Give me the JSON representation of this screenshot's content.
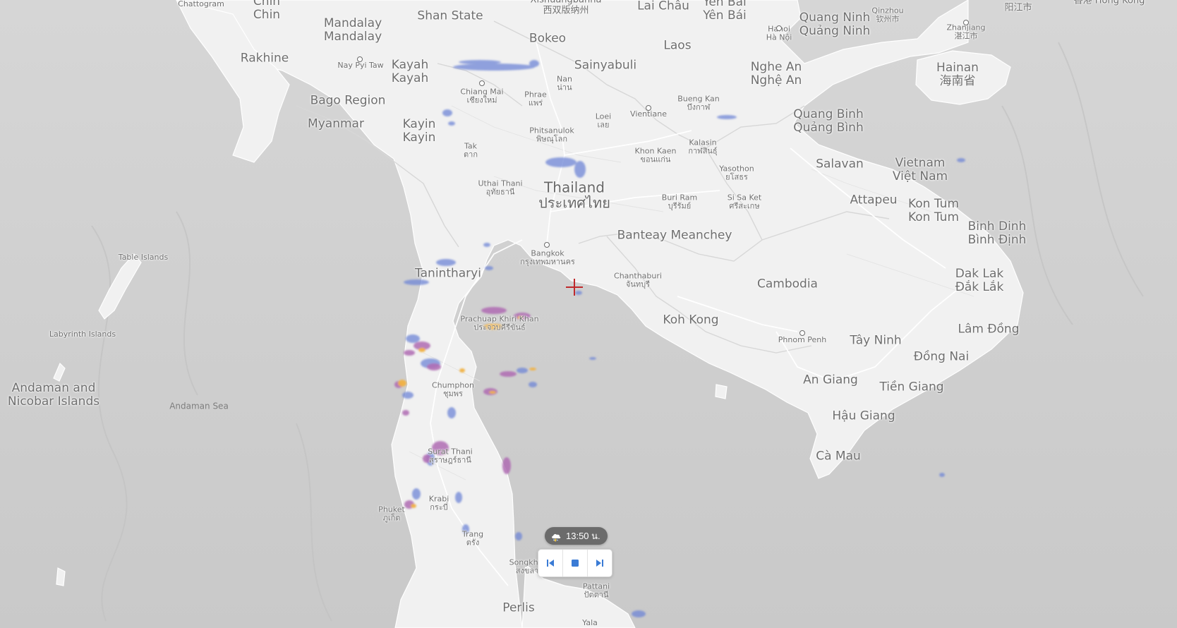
{
  "map": {
    "colors": {
      "water": "#cfcfcf",
      "land": "#f1f1f1",
      "border": "#dcdcdc",
      "roads": "#ffffff",
      "radar_light": "#6f86d6",
      "radar_mid": "#b06bb3",
      "radar_heavy": "#f2b344"
    },
    "marker": {
      "name": "crosshair-marker",
      "color": "#c0292b"
    }
  },
  "labels": [
    {
      "id": "chattogram",
      "text": "Chattogram",
      "level": "l4"
    },
    {
      "id": "chin",
      "text": "Chin",
      "alt": "Chin",
      "level": "l2"
    },
    {
      "id": "mandalay",
      "text": "Mandalay",
      "alt": "Mandalay",
      "level": "l2"
    },
    {
      "id": "shan-state",
      "text": "Shan State",
      "level": "l2"
    },
    {
      "id": "xishuangbanna",
      "text": "Xishuangbanna",
      "alt": "西双版纳州",
      "level": "l3"
    },
    {
      "id": "lai-chau",
      "text": "Lai Châu",
      "level": "l2"
    },
    {
      "id": "yen-bai",
      "text": "Yên Bái",
      "alt": "Yên Bái",
      "level": "l2"
    },
    {
      "id": "qinzhou",
      "text": "Qinzhou",
      "alt": "钦州市",
      "level": "l4"
    },
    {
      "id": "quang-ninh",
      "text": "Quang Ninh",
      "alt": "Quảng Ninh",
      "level": "l2"
    },
    {
      "id": "hanoi",
      "text": "Hanoi",
      "alt": "Hà Nội",
      "level": "l4"
    },
    {
      "id": "zhanjiang",
      "text": "Zhanjiang",
      "alt": "湛江市",
      "level": "l4"
    },
    {
      "id": "yangjiang",
      "text": "阳江市",
      "level": "l3"
    },
    {
      "id": "hong-kong",
      "text": "香港 Hong Kong",
      "level": "l3"
    },
    {
      "id": "hainan",
      "text": "Hainan",
      "alt": "海南省",
      "level": "l2"
    },
    {
      "id": "rakhine",
      "text": "Rakhine",
      "level": "l2"
    },
    {
      "id": "nay-pyi-taw",
      "text": "Nay Pyi Taw",
      "level": "l4"
    },
    {
      "id": "kayah",
      "text": "Kayah",
      "alt": "Kayah",
      "level": "l2"
    },
    {
      "id": "bokeo",
      "text": "Bokeo",
      "level": "l2"
    },
    {
      "id": "laos",
      "text": "Laos",
      "level": "l2"
    },
    {
      "id": "sainyabuli",
      "text": "Sainyabuli",
      "level": "l2"
    },
    {
      "id": "nghe-an",
      "text": "Nghe An",
      "alt": "Nghệ An",
      "level": "l2"
    },
    {
      "id": "bago-region",
      "text": "Bago Region",
      "level": "l2"
    },
    {
      "id": "chiang-mai",
      "text": "Chiang Mai",
      "alt": "เชียงใหม่",
      "level": "l4"
    },
    {
      "id": "phrae",
      "text": "Phrae",
      "alt": "แพร่",
      "level": "l4"
    },
    {
      "id": "nan",
      "text": "Nan",
      "alt": "น่าน",
      "level": "l4"
    },
    {
      "id": "bueng-kan",
      "text": "Bueng Kan",
      "alt": "บึงกาฬ",
      "level": "l4"
    },
    {
      "id": "vientiane",
      "text": "Vientiane",
      "level": "l4"
    },
    {
      "id": "loei",
      "text": "Loei",
      "alt": "เลย",
      "level": "l4"
    },
    {
      "id": "quang-binh",
      "text": "Quang Binh",
      "alt": "Quảng Bình",
      "level": "l2"
    },
    {
      "id": "myanmar",
      "text": "Myanmar",
      "level": "l2"
    },
    {
      "id": "kayin",
      "text": "Kayin",
      "alt": "Kayin",
      "level": "l2"
    },
    {
      "id": "phitsanulok",
      "text": "Phitsanulok",
      "alt": "พิษณุโลก",
      "level": "l4"
    },
    {
      "id": "tak",
      "text": "Tak",
      "alt": "ตาก",
      "level": "l4"
    },
    {
      "id": "kalasin",
      "text": "Kalasin",
      "alt": "กาฬสินธุ์",
      "level": "l4"
    },
    {
      "id": "khon-kaen",
      "text": "Khon Kaen",
      "alt": "ขอนแก่น",
      "level": "l4"
    },
    {
      "id": "salavan",
      "text": "Salavan",
      "level": "l2"
    },
    {
      "id": "vietnam",
      "text": "Vietnam",
      "alt": "Việt Nam",
      "level": "l2"
    },
    {
      "id": "yasothon",
      "text": "Yasothon",
      "alt": "ยโสธร",
      "level": "l4"
    },
    {
      "id": "uthai-thani",
      "text": "Uthai Thani",
      "alt": "อุทัยธานี",
      "level": "l4"
    },
    {
      "id": "thailand",
      "text": "Thailand",
      "alt": "ประเทศไทย",
      "level": "l1"
    },
    {
      "id": "buri-ram",
      "text": "Buri Ram",
      "alt": "บุรีรัมย์",
      "level": "l4"
    },
    {
      "id": "si-sa-ket",
      "text": "Si Sa Ket",
      "alt": "ศรีสะเกษ",
      "level": "l4"
    },
    {
      "id": "attapeu",
      "text": "Attapeu",
      "level": "l2"
    },
    {
      "id": "kon-tum",
      "text": "Kon Tum",
      "alt": "Kon Tum",
      "level": "l2"
    },
    {
      "id": "binh-dinh",
      "text": "Binh Dinh",
      "alt": "Bình Định",
      "level": "l2"
    },
    {
      "id": "banteay-meanchey",
      "text": "Banteay Meanchey",
      "level": "l2"
    },
    {
      "id": "bangkok",
      "text": "Bangkok",
      "alt": "กรุงเทพมหานคร",
      "level": "l4"
    },
    {
      "id": "dak-lak",
      "text": "Dak Lak",
      "alt": "Đắk Lắk",
      "level": "l2"
    },
    {
      "id": "tanintharyi",
      "text": "Tanintharyi",
      "level": "l2"
    },
    {
      "id": "chanthaburi",
      "text": "Chanthaburi",
      "alt": "จันทบุรี",
      "level": "l4"
    },
    {
      "id": "cambodia",
      "text": "Cambodia",
      "level": "l2"
    },
    {
      "id": "table-islands",
      "text": "Table Islands",
      "level": "l4"
    },
    {
      "id": "prachuap",
      "text": "Prachuap Khiri Khan",
      "alt": "ประจวบคีรีขันธ์",
      "level": "l4"
    },
    {
      "id": "koh-kong",
      "text": "Koh Kong",
      "level": "l2"
    },
    {
      "id": "lam-dong",
      "text": "Lâm Đồng",
      "level": "l2"
    },
    {
      "id": "labyrinth-islands",
      "text": "Labyrinth Islands",
      "level": "l4"
    },
    {
      "id": "phnom-penh",
      "text": "Phnom Penh",
      "level": "l4"
    },
    {
      "id": "tay-ninh",
      "text": "Tây Ninh",
      "level": "l2"
    },
    {
      "id": "dong-nai",
      "text": "Đồng Nai",
      "level": "l2"
    },
    {
      "id": "an-giang",
      "text": "An Giang",
      "level": "l2"
    },
    {
      "id": "tien-giang",
      "text": "Tiền Giang",
      "level": "l2"
    },
    {
      "id": "andaman-nicobar",
      "text": "Andaman and",
      "alt": "Nicobar Islands",
      "level": "l2"
    },
    {
      "id": "chumphon",
      "text": "Chumphon",
      "alt": "ชุมพร",
      "level": "l4"
    },
    {
      "id": "andaman-sea",
      "text": "Andaman Sea",
      "level": "l4",
      "water": true
    },
    {
      "id": "hau-giang",
      "text": "Hậu Giang",
      "level": "l2"
    },
    {
      "id": "surat-thani",
      "text": "Surat Thani",
      "alt": "สุราษฎร์ธานี",
      "level": "l4"
    },
    {
      "id": "ca-mau",
      "text": "Cà Mau",
      "level": "l2"
    },
    {
      "id": "krabi",
      "text": "Krabi",
      "alt": "กระบี่",
      "level": "l4"
    },
    {
      "id": "phuket",
      "text": "Phuket",
      "alt": "ภูเก็ต",
      "level": "l4"
    },
    {
      "id": "trang",
      "text": "Trang",
      "alt": "ตรัง",
      "level": "l4"
    },
    {
      "id": "songkhla",
      "text": "Songkhla",
      "alt": "สงขลา",
      "level": "l4"
    },
    {
      "id": "pattani",
      "text": "Pattani",
      "alt": "ปัตตานี",
      "level": "l4"
    },
    {
      "id": "perlis",
      "text": "Perlis",
      "level": "l2"
    },
    {
      "id": "yala",
      "text": "Yala",
      "level": "l4"
    }
  ],
  "cities": [
    "nay-pyi-taw",
    "chiang-mai",
    "vientiane",
    "hanoi",
    "zhanjiang",
    "bangkok",
    "phnom-penh"
  ],
  "controls": {
    "time_label": "13:50 น.",
    "prev_icon": "skip-back-icon",
    "stop_icon": "stop-icon",
    "next_icon": "skip-forward-icon",
    "weather_icon": "storm-cloud-icon"
  }
}
